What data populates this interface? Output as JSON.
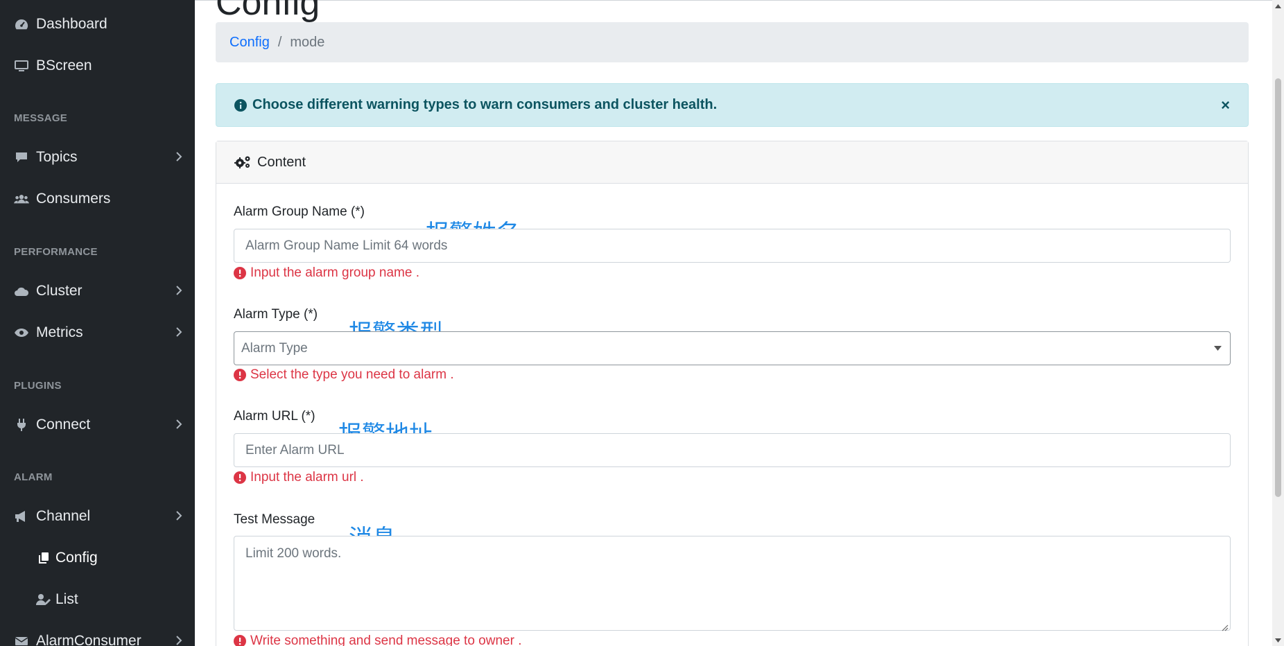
{
  "sidebar": {
    "items": [
      {
        "label": "Dashboard"
      },
      {
        "label": "BScreen"
      },
      {
        "label": "Topics"
      },
      {
        "label": "Consumers"
      },
      {
        "label": "Cluster"
      },
      {
        "label": "Metrics"
      },
      {
        "label": "Connect"
      },
      {
        "label": "Channel"
      },
      {
        "label": "Config"
      },
      {
        "label": "List"
      },
      {
        "label": "AlarmConsumer"
      }
    ],
    "headings": {
      "message": "MESSAGE",
      "performance": "PERFORMANCE",
      "plugins": "PLUGINS",
      "alarm": "ALARM"
    }
  },
  "page": {
    "title": "Config"
  },
  "breadcrumb": {
    "link": "Config",
    "separator": "/",
    "active": "mode"
  },
  "alert": {
    "message": "Choose different warning types to warn consumers and cluster health.",
    "close": "×"
  },
  "card": {
    "header": "Content"
  },
  "form": {
    "group_name": {
      "label": "Alarm Group Name (*)",
      "placeholder": "Alarm Group Name Limit 64 words",
      "error": "Input the alarm group name .",
      "annotation": "报警姓名"
    },
    "alarm_type": {
      "label": "Alarm Type (*)",
      "placeholder": "Alarm Type",
      "error": "Select the type you need to alarm .",
      "annotation": "报警类型"
    },
    "alarm_url": {
      "label": "Alarm URL (*)",
      "placeholder": "Enter Alarm URL",
      "error": "Input the alarm url .",
      "annotation": "报警地址"
    },
    "test_message": {
      "label": "Test Message",
      "placeholder": "Limit 200 words.",
      "error": "Write something and send message to owner .",
      "annotation": "消息"
    }
  },
  "colors": {
    "sidebar_bg": "#212529",
    "link": "#0d6efd",
    "error": "#dc3545",
    "alert_bg": "#d1ecf1",
    "annotation": "#1e88e5"
  }
}
